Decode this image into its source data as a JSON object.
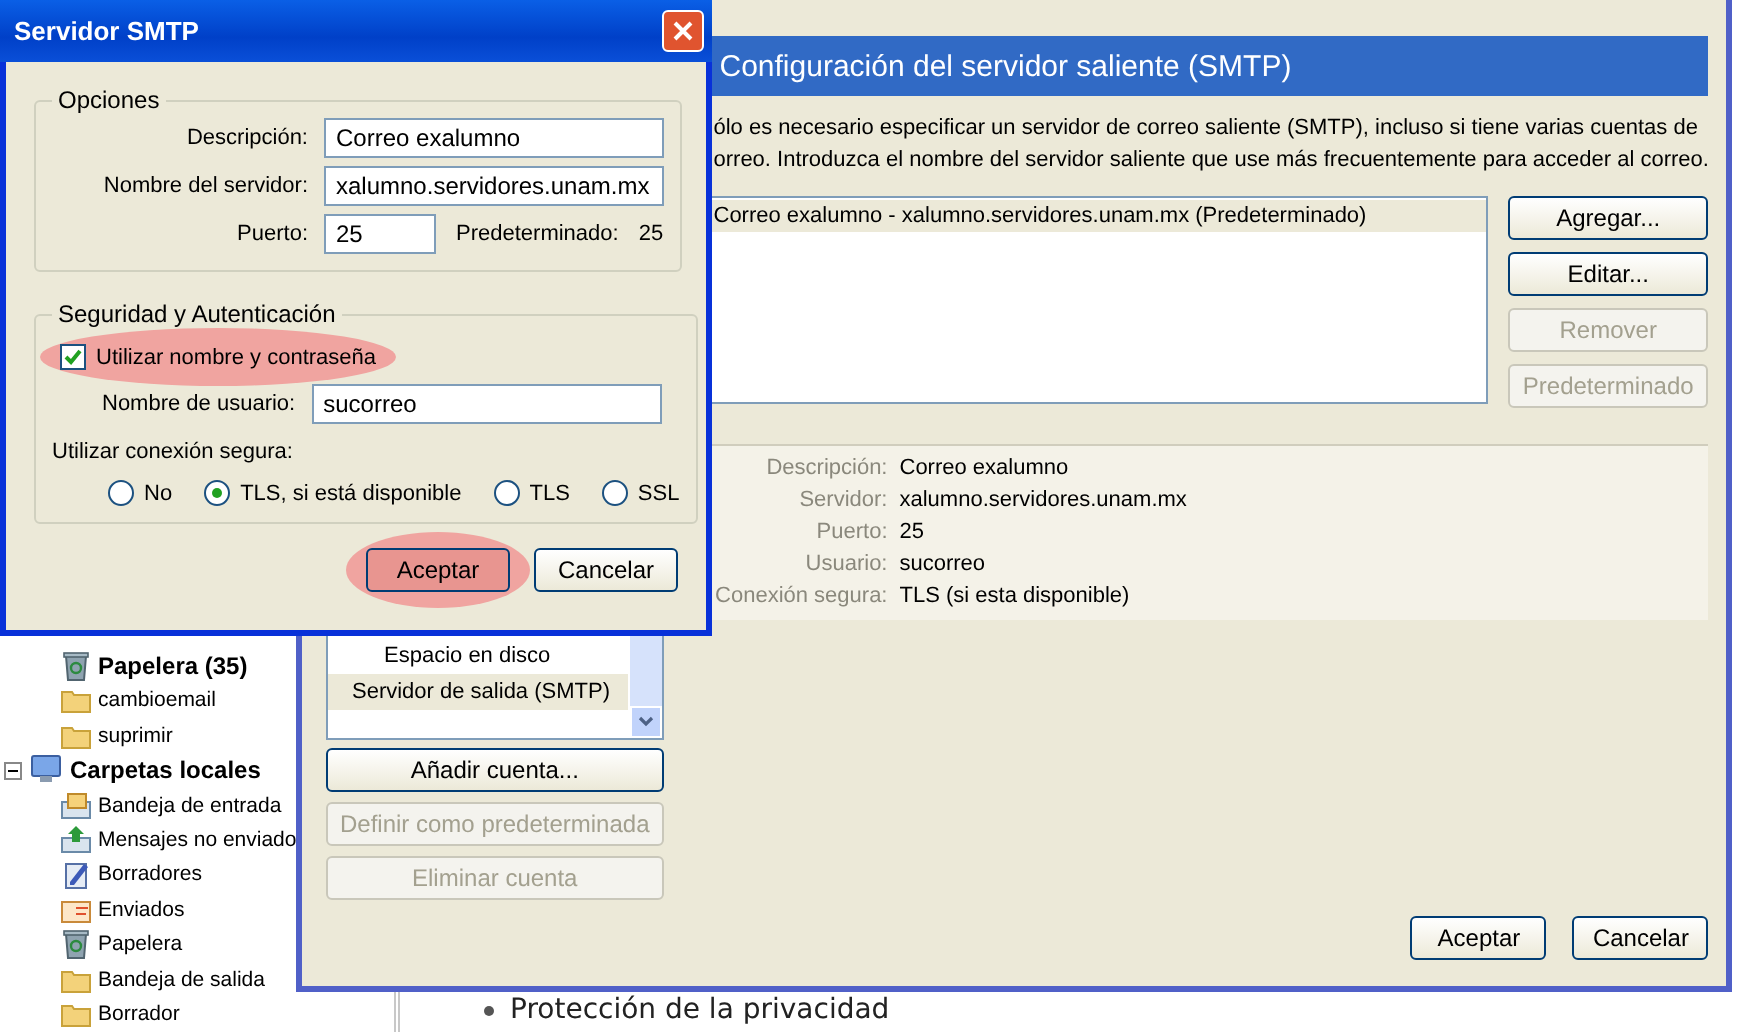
{
  "mail_window": {
    "account_folders": [
      {
        "label": "Papelera (35)",
        "kind": "trash",
        "unread": true
      },
      {
        "label": "cambioemail",
        "kind": "folder",
        "unread": false
      },
      {
        "label": "suprimir",
        "kind": "folder",
        "unread": false
      }
    ],
    "local_folders": {
      "label": "Carpetas locales",
      "expanded": true,
      "children": [
        {
          "label": "Bandeja de entrada",
          "kind": "inbox"
        },
        {
          "label": "Mensajes no enviado",
          "kind": "unsent"
        },
        {
          "label": "Borradores",
          "kind": "drafts"
        },
        {
          "label": "Enviados",
          "kind": "sent"
        },
        {
          "label": "Papelera",
          "kind": "trash"
        },
        {
          "label": "Bandeja de salida",
          "kind": "folder"
        },
        {
          "label": "Borrador",
          "kind": "folder"
        }
      ]
    },
    "content_bullet": "Protección de la privacidad"
  },
  "account_settings": {
    "tree": [
      {
        "label": "Espacio en disco",
        "selected": false
      },
      {
        "label": "Servidor de salida (SMTP)",
        "selected": true
      }
    ],
    "account_buttons": [
      {
        "label": "Añadir cuenta...",
        "disabled": false
      },
      {
        "label": "Definir como predeterminada",
        "disabled": true
      },
      {
        "label": "Eliminar cuenta",
        "disabled": true
      }
    ],
    "header": "Configuración del servidor saliente (SMTP)",
    "description_lines": [
      "ólo es necesario especificar un servidor de correo saliente (SMTP), incluso si tiene varias cuentas de",
      "orreo. Introduzca el nombre del servidor saliente que use más frecuentemente para acceder al correo."
    ],
    "servers": [
      {
        "label": "Correo exalumno - xalumno.servidores.unam.mx (Predeterminado)",
        "selected": true
      }
    ],
    "server_buttons": [
      {
        "label": "Agregar...",
        "disabled": false
      },
      {
        "label": "Editar...",
        "disabled": false
      },
      {
        "label": "Remover",
        "disabled": true
      },
      {
        "label": "Predeterminado",
        "disabled": true
      }
    ],
    "details": [
      {
        "label": "Descripción:",
        "value": "Correo exalumno"
      },
      {
        "label": "Servidor:",
        "value": "xalumno.servidores.unam.mx"
      },
      {
        "label": "Puerto:",
        "value": "25"
      },
      {
        "label": "Usuario:",
        "value": "sucorreo"
      },
      {
        "label": "Conexión segura:",
        "value": "TLS (si esta disponible)"
      }
    ],
    "footer_buttons": [
      "Aceptar",
      "Cancelar"
    ]
  },
  "smtp_dialog": {
    "title": "Servidor SMTP",
    "options": {
      "legend": "Opciones",
      "fields": [
        {
          "label": "Descripción:",
          "value": "Correo exalumno"
        },
        {
          "label": "Nombre del servidor:",
          "value": "xalumno.servidores.unam.mx"
        }
      ],
      "port": {
        "label": "Puerto:",
        "value": "25",
        "default_label": "Predeterminado:",
        "default_value": "25"
      }
    },
    "security": {
      "legend": "Seguridad y Autenticación",
      "use_auth": {
        "label": "Utilizar nombre y contraseña",
        "checked": true,
        "highlighted": true
      },
      "username": {
        "label": "Nombre de usuario:",
        "value": "sucorreo"
      },
      "secure_label": "Utilizar conexión segura:",
      "radios": [
        {
          "label": "No",
          "selected": false
        },
        {
          "label": "TLS, si está disponible",
          "selected": true
        },
        {
          "label": "TLS",
          "selected": false
        },
        {
          "label": "SSL",
          "selected": false
        }
      ]
    },
    "buttons": [
      {
        "label": "Aceptar",
        "highlighted": true
      },
      {
        "label": "Cancelar",
        "highlighted": false
      }
    ]
  }
}
